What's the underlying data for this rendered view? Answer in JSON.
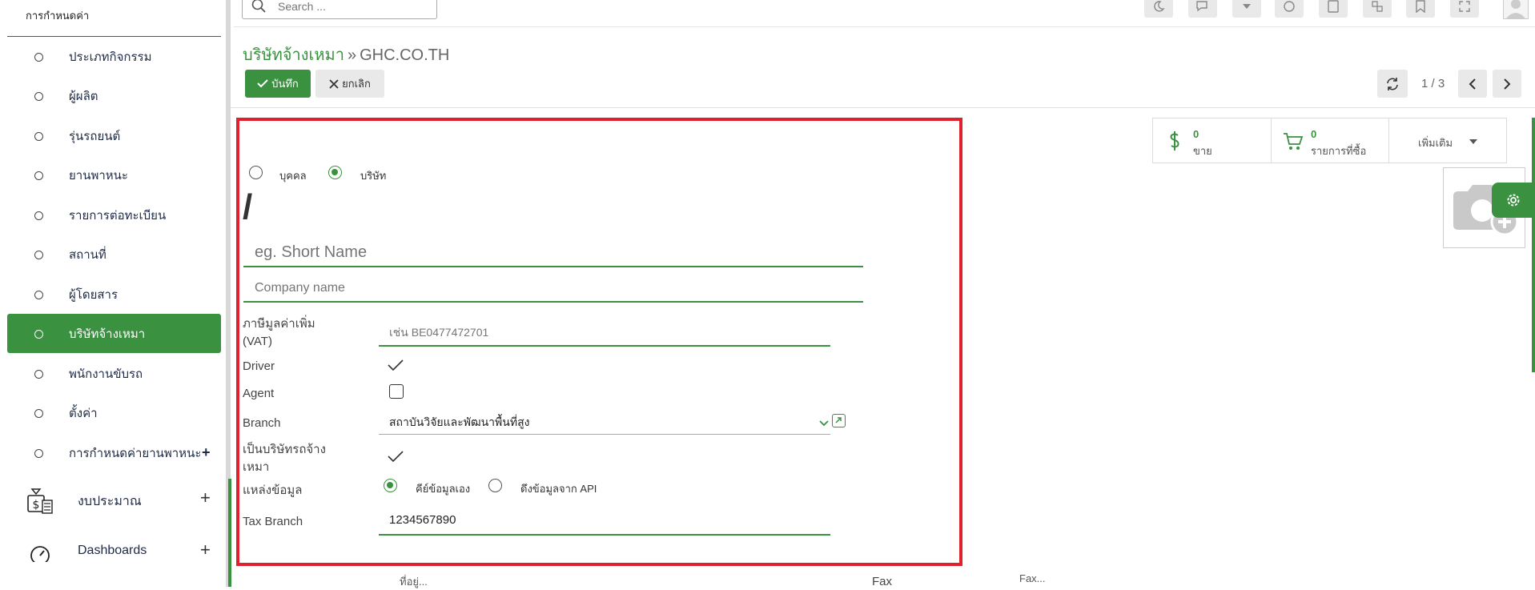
{
  "sidebar": {
    "header": "การกำหนดค่า",
    "items": [
      {
        "label": "ประเภทกิจกรรม"
      },
      {
        "label": "ผู้ผลิต"
      },
      {
        "label": "รุ่นรถยนต์"
      },
      {
        "label": "ยานพาหนะ"
      },
      {
        "label": "รายการต่อทะเบียน"
      },
      {
        "label": "สถานที่"
      },
      {
        "label": "ผู้โดยสาร"
      },
      {
        "label": "บริษัทจ้างเหมา",
        "active": true
      },
      {
        "label": "พนักงานขับรถ"
      },
      {
        "label": "ตั้งค่า"
      },
      {
        "label": "การกำหนดค่ายานพาหนะ"
      }
    ],
    "expand_symbol": "+",
    "sections": [
      {
        "label": "งบประมาณ",
        "icon": "budget-money-icon"
      },
      {
        "label": "Dashboards",
        "icon": "dashboard-gauge-icon"
      }
    ]
  },
  "topbar": {
    "search_placeholder": "Search ...",
    "icons": [
      "moon-icon",
      "chat-icon",
      "caret-down-icon",
      "activity-icon",
      "calculator-icon",
      "settings-menu-icon",
      "bookmark-icon",
      "expand-icon",
      "user-icon"
    ]
  },
  "breadcrumb": {
    "parent": "บริษัทจ้างเหมา",
    "separator": "»",
    "current": "GHC.CO.TH"
  },
  "actions": {
    "save_label": "บันทึก",
    "cancel_label": "ยกเลิก"
  },
  "pager": {
    "text": "1 / 3"
  },
  "form": {
    "type_options": [
      {
        "label": "บุคคล",
        "selected": false
      },
      {
        "label": "บริษัท",
        "selected": true
      }
    ],
    "slash": "/",
    "short_name_placeholder": "eg. Short Name",
    "company_name_placeholder": "Company name",
    "vat_label": "ภาษีมูลค่าเพิ่ม (VAT)",
    "vat_placeholder": "เช่น BE0477472701",
    "driver_label": "Driver",
    "driver_checked": true,
    "agent_label": "Agent",
    "agent_checked": false,
    "branch_label": "Branch",
    "branch_value": "สถาบันวิจัยและพัฒนาพื้นที่สูง",
    "contractor_label": "เป็นบริษัทรถจ้างเหมา",
    "contractor_checked": true,
    "source_label": "แหล่งข้อมูล",
    "source_options": [
      {
        "label": "คีย์ข้อมูลเอง",
        "selected": true
      },
      {
        "label": "ดึงข้อมูลจาก API",
        "selected": false
      }
    ],
    "tax_branch_label": "Tax Branch",
    "tax_branch_value": "1234567890"
  },
  "stats": {
    "sales_count": "0",
    "sales_label": "ขาย",
    "purchase_count": "0",
    "purchase_label": "รายการที่ซื้อ",
    "more_label": "เพิ่มเติม"
  },
  "bottom": {
    "address_placeholder": "ที่อยู่...",
    "fax_label": "Fax",
    "fax_placeholder": "Fax..."
  },
  "colors": {
    "brand_green": "#3a9140",
    "highlight_red": "#e0202c"
  }
}
